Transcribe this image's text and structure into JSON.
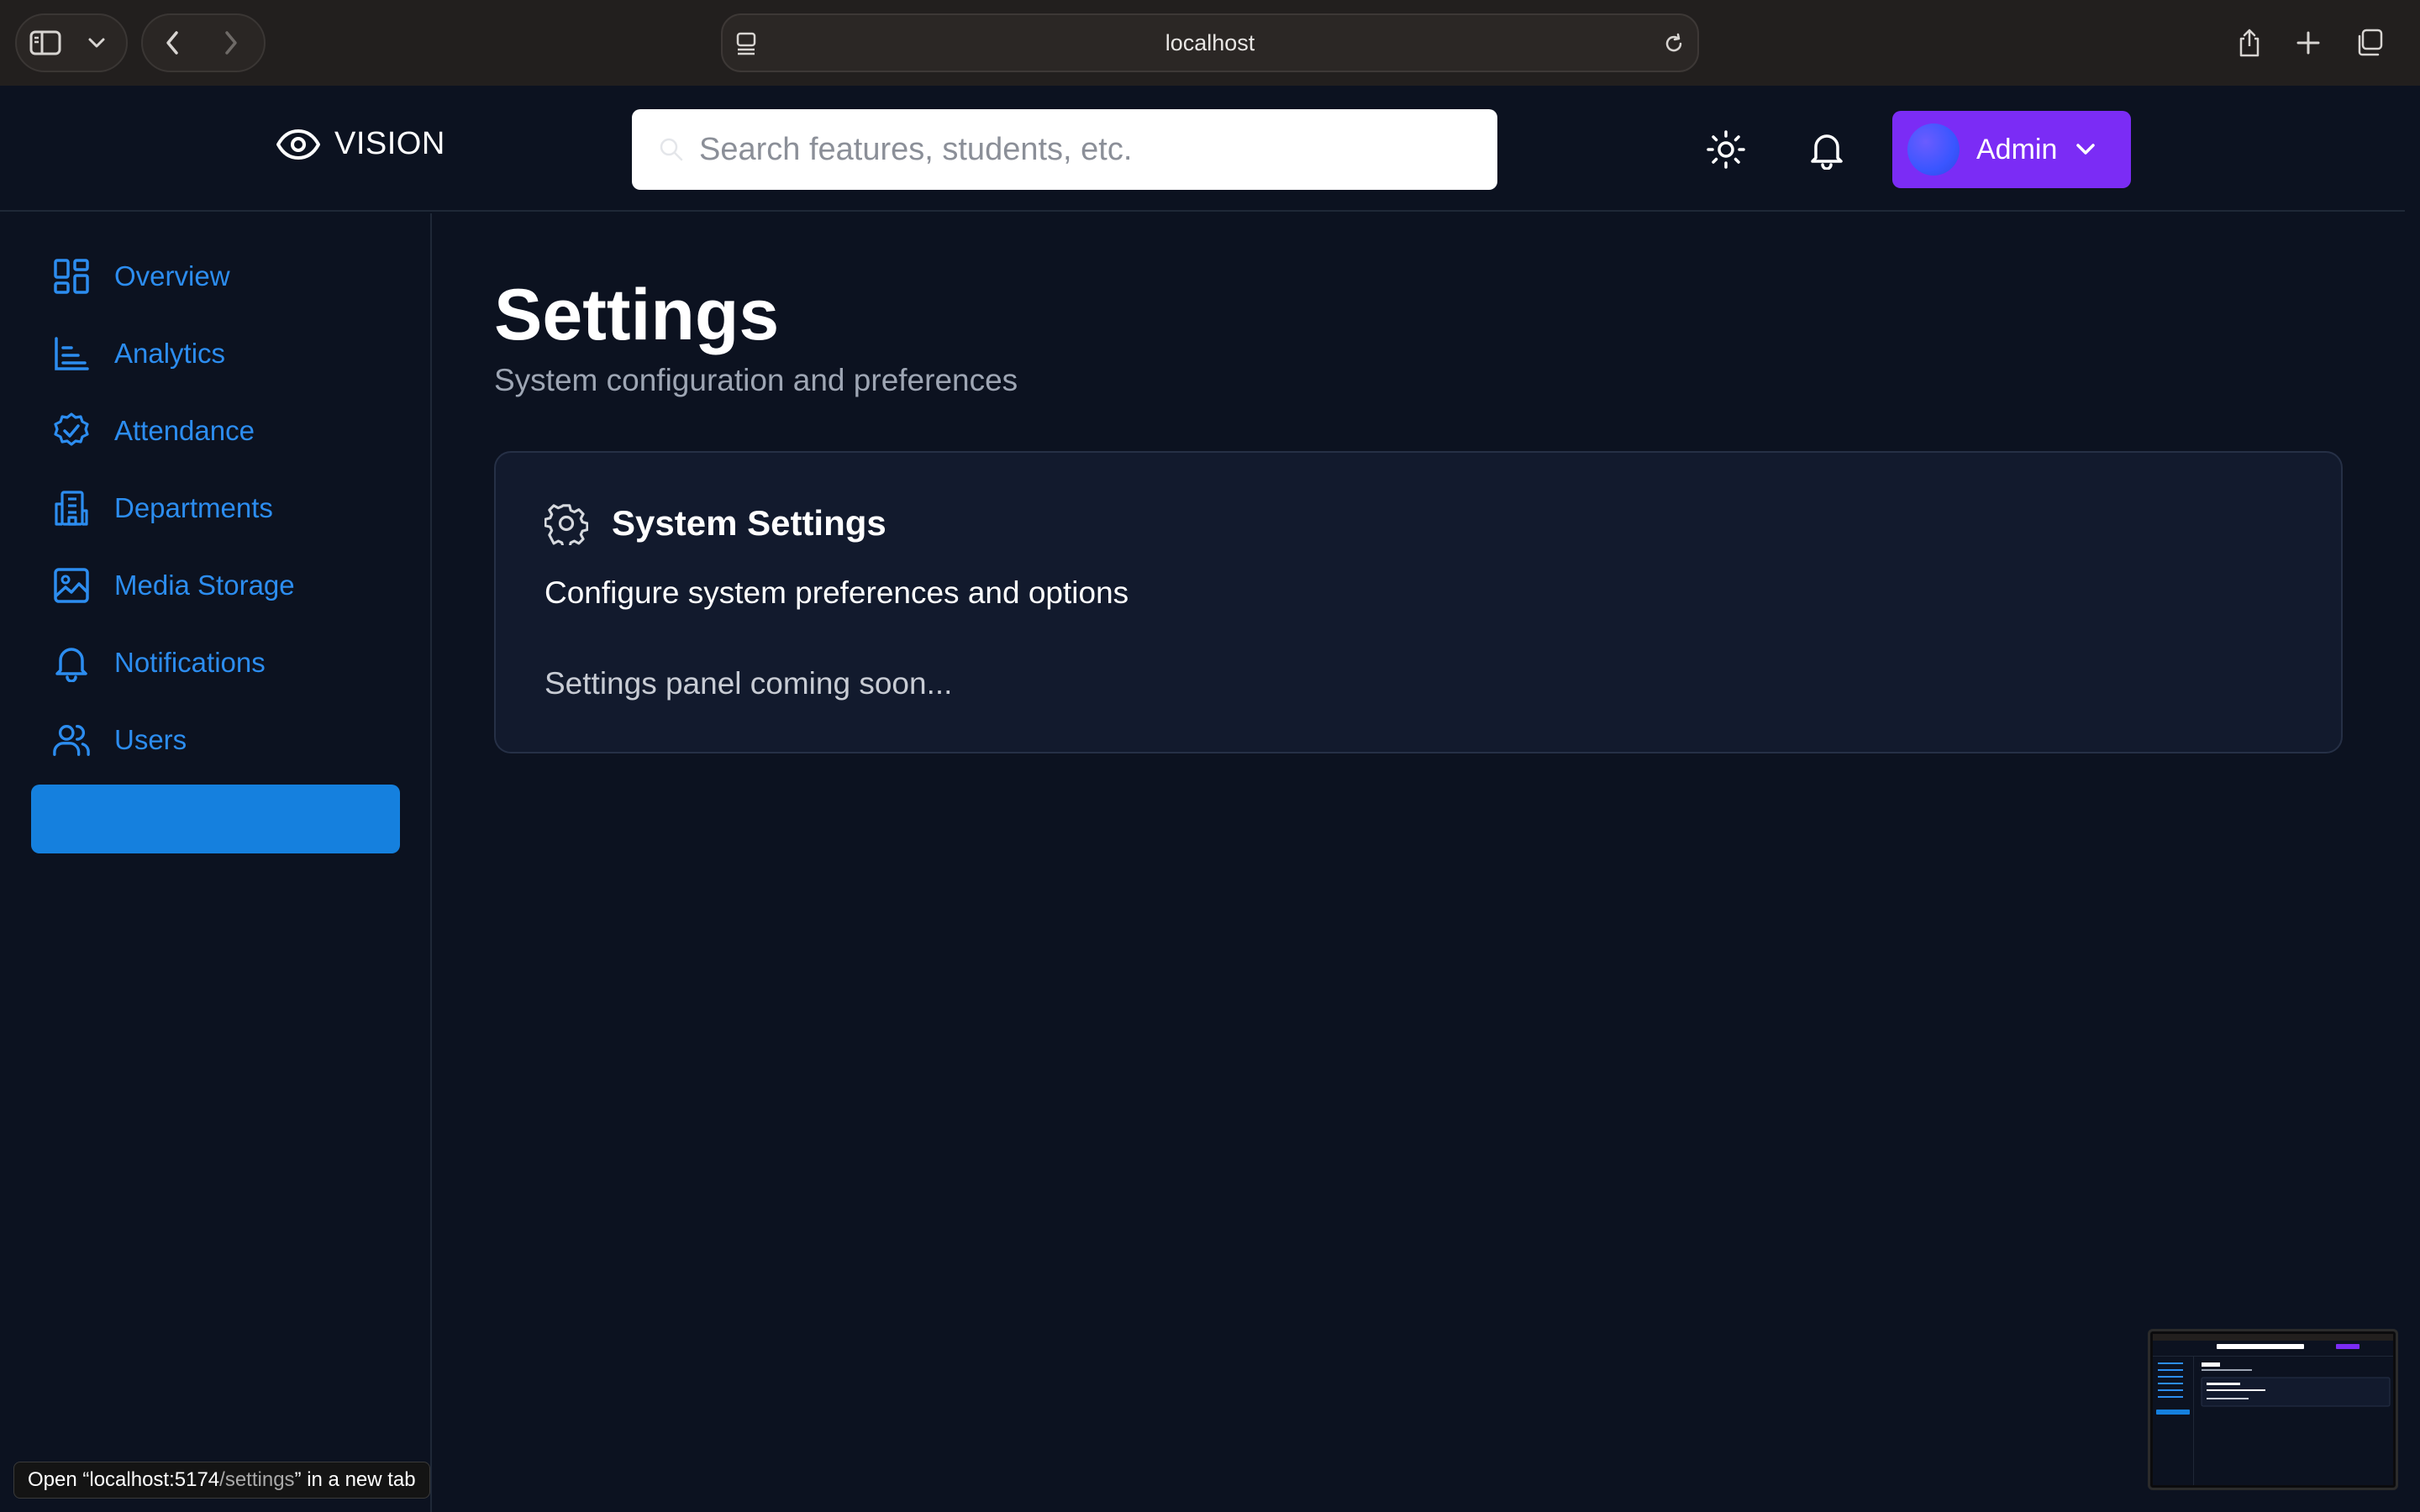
{
  "browser": {
    "url": "localhost",
    "status_tooltip": {
      "prefix": "Open “localhost:5174",
      "path": "/settings",
      "suffix": "” in a new tab"
    }
  },
  "header": {
    "brand": "VISION",
    "search": {
      "placeholder": "Search features, students, etc."
    },
    "user_menu": {
      "label": "Admin"
    }
  },
  "sidebar": {
    "items": [
      {
        "label": "Overview",
        "icon": "grid-icon"
      },
      {
        "label": "Analytics",
        "icon": "bar-chart-icon"
      },
      {
        "label": "Attendance",
        "icon": "badge-check-icon"
      },
      {
        "label": "Departments",
        "icon": "building-icon"
      },
      {
        "label": "Media Storage",
        "icon": "image-icon"
      },
      {
        "label": "Notifications",
        "icon": "bell-icon"
      },
      {
        "label": "Users",
        "icon": "users-icon"
      }
    ],
    "active_item_label": ""
  },
  "main": {
    "title": "Settings",
    "subtitle": "System configuration and preferences",
    "card": {
      "title": "System Settings",
      "description": "Configure system preferences and options",
      "note": "Settings panel coming soon..."
    }
  },
  "colors": {
    "background": "#0c1220",
    "accent_blue": "#2c8df0",
    "active_nav": "#1580de",
    "admin_button": "#7b2cf5",
    "card": "#121a2d"
  }
}
